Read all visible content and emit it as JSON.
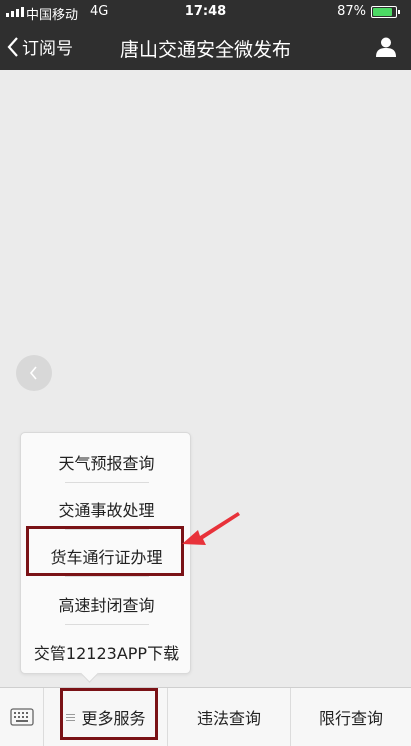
{
  "status_bar": {
    "carrier": "中国移动",
    "network": "4G",
    "time": "17:48",
    "battery": "87%",
    "battery_level": 0.87
  },
  "nav": {
    "back_label": "订阅号",
    "title": "唐山交通安全微发布"
  },
  "menu": {
    "items": [
      {
        "label": "天气预报查询"
      },
      {
        "label": "交通事故处理"
      },
      {
        "label": "货车通行证办理"
      },
      {
        "label": "高速封闭查询"
      },
      {
        "label": "交管12123APP下载"
      }
    ]
  },
  "tabs": [
    {
      "label": "更多服务"
    },
    {
      "label": "违法查询"
    },
    {
      "label": "限行查询"
    }
  ],
  "colors": {
    "bar": "#2f2f2f",
    "highlight": "#7a1216",
    "arrow": "#e8323a",
    "battery": "#4cd964"
  }
}
